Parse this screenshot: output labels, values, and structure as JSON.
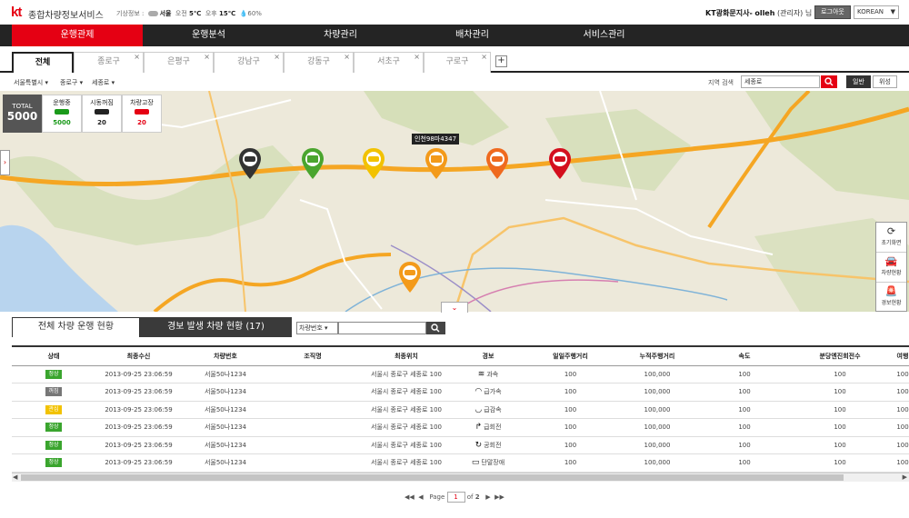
{
  "header": {
    "logo": "kt",
    "service_title": "종합차량정보서비스",
    "weather_label": "기상정보 :",
    "weather_city": "서울",
    "am_label": "오전",
    "am_temp": "5℃",
    "pm_label": "오후",
    "pm_temp": "15℃",
    "humidity": "60%",
    "user_org": "KT광화문지사-",
    "user_name": "olleh",
    "user_role": "(관리자) 님",
    "logout_label": "로그아웃",
    "language": "KOREAN"
  },
  "nav": {
    "items": [
      {
        "label": "운행관제"
      },
      {
        "label": "운행분석"
      },
      {
        "label": "차량관리"
      },
      {
        "label": "배차관리"
      },
      {
        "label": "서비스관리"
      }
    ]
  },
  "tabs": {
    "items": [
      {
        "label": "전체"
      },
      {
        "label": "종로구"
      },
      {
        "label": "은평구"
      },
      {
        "label": "강남구"
      },
      {
        "label": "강동구"
      },
      {
        "label": "서초구"
      },
      {
        "label": "구로구"
      }
    ],
    "close_glyph": "×",
    "add_glyph": "+"
  },
  "filters": {
    "city": "서울특별시",
    "district": "종로구",
    "road": "세종로",
    "search_label": "지역 검색",
    "search_value": "세종로",
    "map_mode_normal": "일반",
    "map_mode_satellite": "위성"
  },
  "summary": {
    "total_label": "TOTAL",
    "total_value": "5000",
    "stats": [
      {
        "label": "운행중",
        "value": "5000",
        "color": "#1a9a1a"
      },
      {
        "label": "시동꺼짐",
        "value": "20",
        "color": "#222222"
      },
      {
        "label": "차량고장",
        "value": "20",
        "color": "#e50013"
      }
    ]
  },
  "map": {
    "callout": "인천98마4347",
    "tools": [
      {
        "label": "초기화면",
        "icon": "refresh-icon"
      },
      {
        "label": "차량현황",
        "icon": "car-icon"
      },
      {
        "label": "경보현황",
        "icon": "siren-icon"
      }
    ],
    "colors": {
      "black": "#333333",
      "green": "#4aa52e",
      "yellow": "#f2c200",
      "orange": "#f39a1a",
      "red_orange": "#ef6a1f",
      "red": "#d40f1e"
    }
  },
  "bottom": {
    "tab_all": "전체 차량 운행 현황",
    "tab_alarm": "경보 발생 차량 현황 (17)",
    "select_value": "차량번호"
  },
  "table": {
    "columns": [
      "상태",
      "최종수신",
      "차량번호",
      "조직명",
      "최종위치",
      "경보",
      "일일주행거리",
      "누적주행거리",
      "속도",
      "분당엔진회전수",
      "여행"
    ],
    "rows": [
      {
        "status": "정상",
        "status_color": "#3aa52e",
        "time": "2013-09-25 23:06:59",
        "plate": "서울50나1234",
        "org": "",
        "loc": "서울시 종로구 세종로 100",
        "alarm_icon": "speed-icon",
        "alarm": "과속",
        "daily": "100",
        "total": "100,000",
        "speed": "100",
        "rpm": "100",
        "trip": "100"
      },
      {
        "status": "꺼짐",
        "status_color": "#777777",
        "time": "2013-09-25 23:06:59",
        "plate": "서울50나1234",
        "org": "",
        "loc": "서울시 종로구 세종로 100",
        "alarm_icon": "accel-icon",
        "alarm": "급가속",
        "daily": "100",
        "total": "100,000",
        "speed": "100",
        "rpm": "100",
        "trip": "100"
      },
      {
        "status": "관심",
        "status_color": "#f2c200",
        "time": "2013-09-25 23:06:59",
        "plate": "서울50나1234",
        "org": "",
        "loc": "서울시 종로구 세종로 100",
        "alarm_icon": "decel-icon",
        "alarm": "급감속",
        "daily": "100",
        "total": "100,000",
        "speed": "100",
        "rpm": "100",
        "trip": "100"
      },
      {
        "status": "정상",
        "status_color": "#3aa52e",
        "time": "2013-09-25 23:06:59",
        "plate": "서울50나1234",
        "org": "",
        "loc": "서울시 종로구 세종로 100",
        "alarm_icon": "sharp-turn-icon",
        "alarm": "급회전",
        "daily": "100",
        "total": "100,000",
        "speed": "100",
        "rpm": "100",
        "trip": "100"
      },
      {
        "status": "정상",
        "status_color": "#3aa52e",
        "time": "2013-09-25 23:06:59",
        "plate": "서울50나1234",
        "org": "",
        "loc": "서울시 종로구 세종로 100",
        "alarm_icon": "u-turn-icon",
        "alarm": "공회전",
        "daily": "100",
        "total": "100,000",
        "speed": "100",
        "rpm": "100",
        "trip": "100"
      },
      {
        "status": "정상",
        "status_color": "#3aa52e",
        "time": "2013-09-25 23:06:59",
        "plate": "서울50나1234",
        "org": "",
        "loc": "서울시 종로구 세종로 100",
        "alarm_icon": "terminal-fault-icon",
        "alarm": "단말장애",
        "daily": "100",
        "total": "100,000",
        "speed": "100",
        "rpm": "100",
        "trip": "100"
      }
    ]
  },
  "pager": {
    "page_label": "Page",
    "current": "1",
    "of_label": "of",
    "total": "2"
  }
}
